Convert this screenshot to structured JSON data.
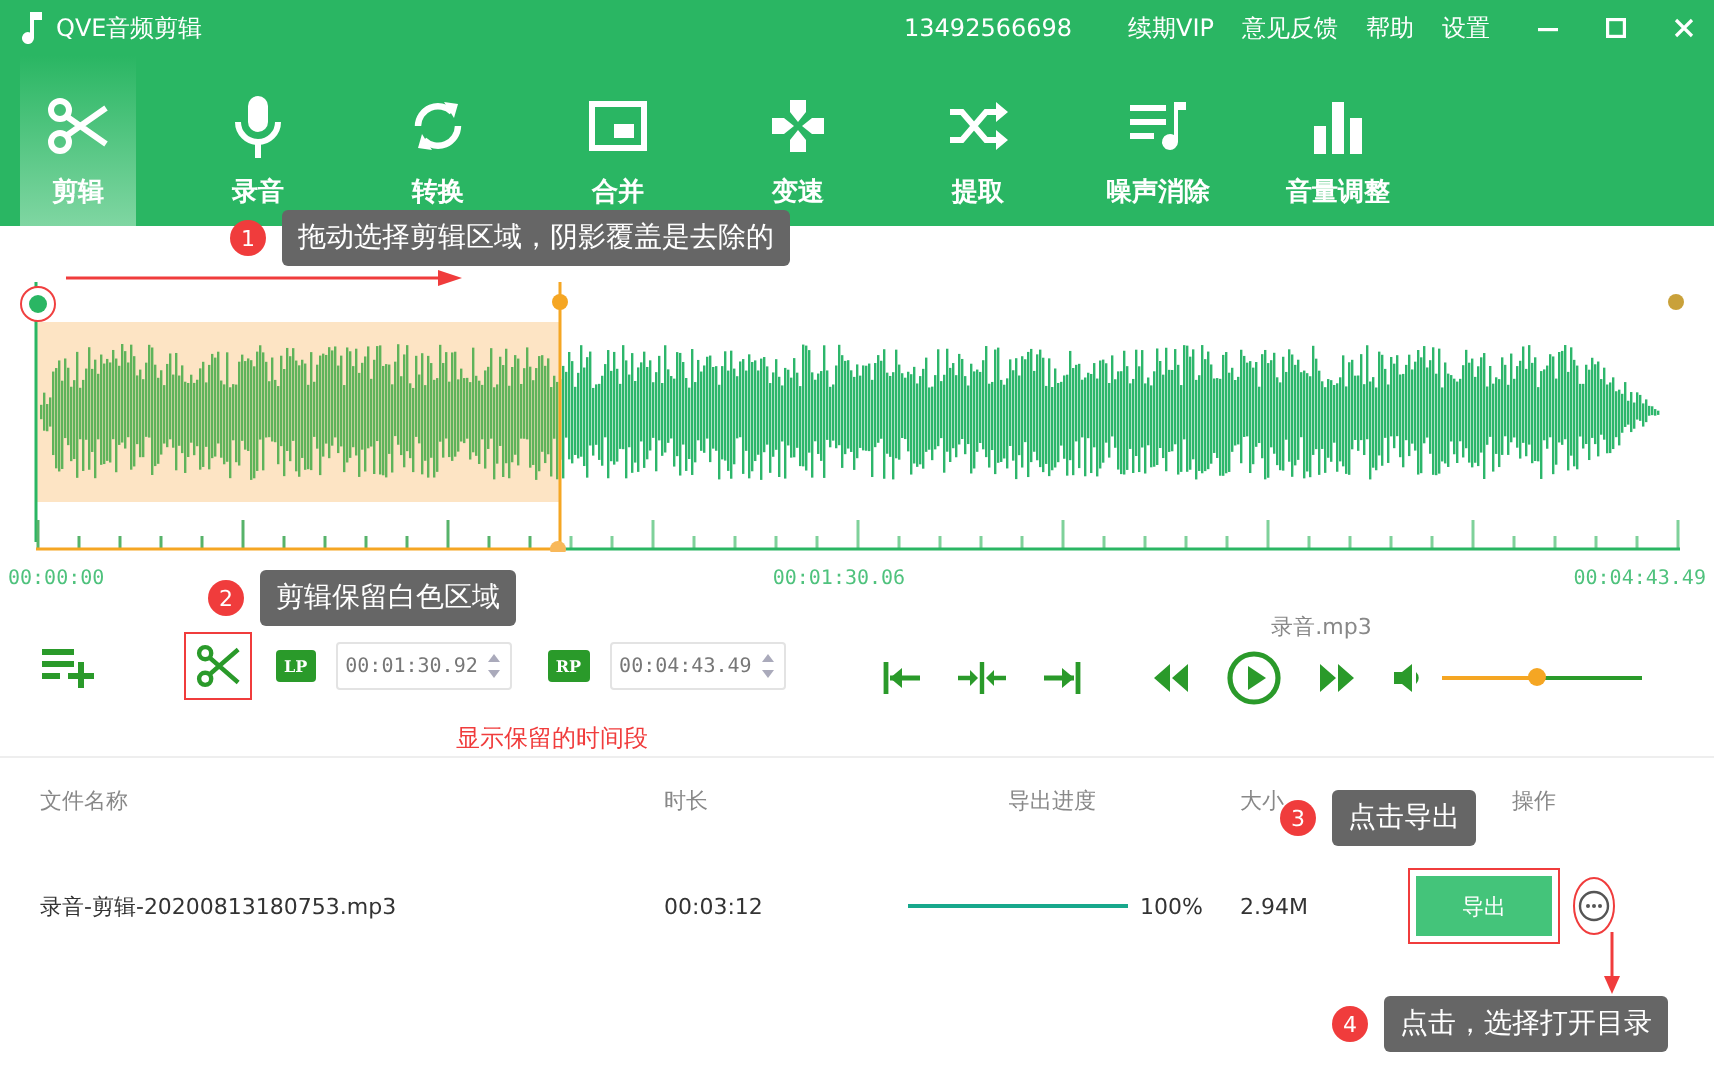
{
  "window": {
    "title": "QVE音频剪辑",
    "account": "13492566698",
    "links": [
      "续期VIP",
      "意见反馈",
      "帮助",
      "设置"
    ]
  },
  "tabs": [
    {
      "label": "剪辑",
      "selected": true
    },
    {
      "label": "录音",
      "selected": false
    },
    {
      "label": "转换",
      "selected": false
    },
    {
      "label": "合并",
      "selected": false
    },
    {
      "label": "变速",
      "selected": false
    },
    {
      "label": "提取",
      "selected": false
    },
    {
      "label": "噪声消除",
      "selected": false
    },
    {
      "label": "音量调整",
      "selected": false
    }
  ],
  "timeline": {
    "start": "00:00:00",
    "middle": "00:01:30.06",
    "end": "00:04:43.49"
  },
  "controls": {
    "file_name": "录音.mp3",
    "lp_label": "LP",
    "lp_value": "00:01:30.92",
    "rp_label": "RP",
    "rp_value": "00:04:43.49",
    "volume": {
      "level": 0.47
    },
    "hint": "显示保留的时间段"
  },
  "table": {
    "columns": [
      "文件名称",
      "时长",
      "导出进度",
      "大小",
      "操作"
    ],
    "rows": [
      {
        "name": "录音-剪辑-20200813180753.mp3",
        "duration": "00:03:12",
        "progress": {
          "level": 1.0
        },
        "percent": "100%",
        "size": "2.94M",
        "button": "导出"
      }
    ]
  },
  "callouts": [
    {
      "number": "1",
      "text": "拖动选择剪辑区域，阴影覆盖是去除的"
    },
    {
      "number": "2",
      "text": "剪辑保留白色区域"
    },
    {
      "number": "3",
      "text": "点击导出"
    },
    {
      "number": "4",
      "text": "点击，选择打开目录"
    }
  ]
}
